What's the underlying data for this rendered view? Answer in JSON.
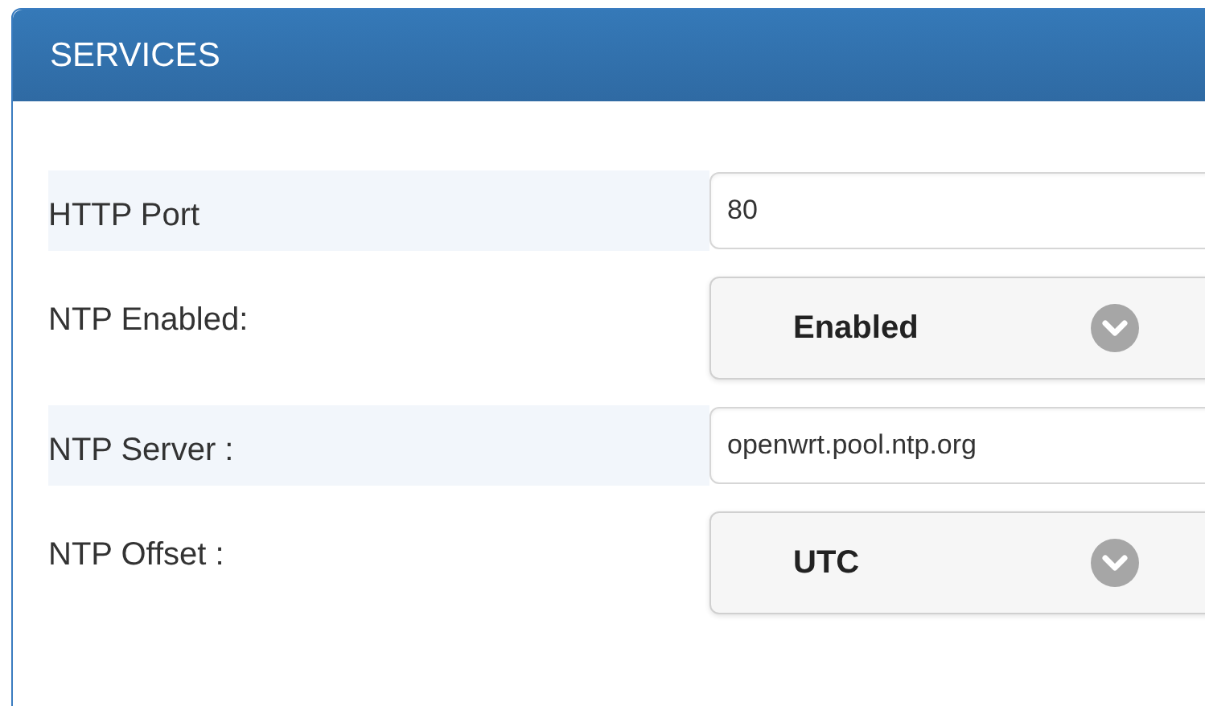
{
  "panel": {
    "title": "SERVICES"
  },
  "rows": [
    {
      "label": "HTTP Port",
      "kind": "text",
      "value": "80"
    },
    {
      "label": "NTP Enabled:",
      "kind": "select",
      "value": "Enabled"
    },
    {
      "label": "NTP Server :",
      "kind": "text",
      "value": "openwrt.pool.ntp.org"
    },
    {
      "label": "NTP Offset :",
      "kind": "select",
      "value": "UTC"
    }
  ]
}
